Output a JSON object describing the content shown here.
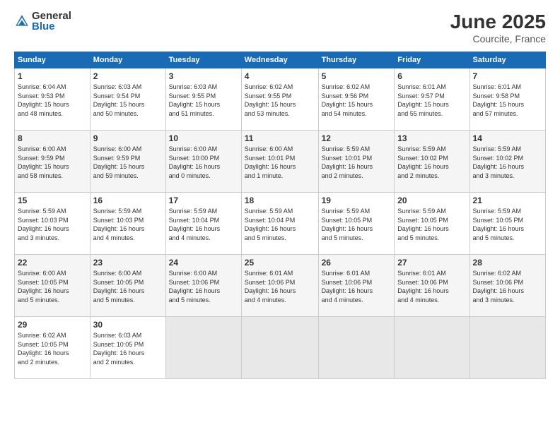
{
  "logo": {
    "general": "General",
    "blue": "Blue"
  },
  "title": "June 2025",
  "subtitle": "Courcite, France",
  "weekdays": [
    "Sunday",
    "Monday",
    "Tuesday",
    "Wednesday",
    "Thursday",
    "Friday",
    "Saturday"
  ],
  "weeks": [
    [
      {
        "day": "1",
        "info": "Sunrise: 6:04 AM\nSunset: 9:53 PM\nDaylight: 15 hours\nand 48 minutes."
      },
      {
        "day": "2",
        "info": "Sunrise: 6:03 AM\nSunset: 9:54 PM\nDaylight: 15 hours\nand 50 minutes."
      },
      {
        "day": "3",
        "info": "Sunrise: 6:03 AM\nSunset: 9:55 PM\nDaylight: 15 hours\nand 51 minutes."
      },
      {
        "day": "4",
        "info": "Sunrise: 6:02 AM\nSunset: 9:55 PM\nDaylight: 15 hours\nand 53 minutes."
      },
      {
        "day": "5",
        "info": "Sunrise: 6:02 AM\nSunset: 9:56 PM\nDaylight: 15 hours\nand 54 minutes."
      },
      {
        "day": "6",
        "info": "Sunrise: 6:01 AM\nSunset: 9:57 PM\nDaylight: 15 hours\nand 55 minutes."
      },
      {
        "day": "7",
        "info": "Sunrise: 6:01 AM\nSunset: 9:58 PM\nDaylight: 15 hours\nand 57 minutes."
      }
    ],
    [
      {
        "day": "8",
        "info": "Sunrise: 6:00 AM\nSunset: 9:59 PM\nDaylight: 15 hours\nand 58 minutes."
      },
      {
        "day": "9",
        "info": "Sunrise: 6:00 AM\nSunset: 9:59 PM\nDaylight: 15 hours\nand 59 minutes."
      },
      {
        "day": "10",
        "info": "Sunrise: 6:00 AM\nSunset: 10:00 PM\nDaylight: 16 hours\nand 0 minutes."
      },
      {
        "day": "11",
        "info": "Sunrise: 6:00 AM\nSunset: 10:01 PM\nDaylight: 16 hours\nand 1 minute."
      },
      {
        "day": "12",
        "info": "Sunrise: 5:59 AM\nSunset: 10:01 PM\nDaylight: 16 hours\nand 2 minutes."
      },
      {
        "day": "13",
        "info": "Sunrise: 5:59 AM\nSunset: 10:02 PM\nDaylight: 16 hours\nand 2 minutes."
      },
      {
        "day": "14",
        "info": "Sunrise: 5:59 AM\nSunset: 10:02 PM\nDaylight: 16 hours\nand 3 minutes."
      }
    ],
    [
      {
        "day": "15",
        "info": "Sunrise: 5:59 AM\nSunset: 10:03 PM\nDaylight: 16 hours\nand 3 minutes."
      },
      {
        "day": "16",
        "info": "Sunrise: 5:59 AM\nSunset: 10:03 PM\nDaylight: 16 hours\nand 4 minutes."
      },
      {
        "day": "17",
        "info": "Sunrise: 5:59 AM\nSunset: 10:04 PM\nDaylight: 16 hours\nand 4 minutes."
      },
      {
        "day": "18",
        "info": "Sunrise: 5:59 AM\nSunset: 10:04 PM\nDaylight: 16 hours\nand 5 minutes."
      },
      {
        "day": "19",
        "info": "Sunrise: 5:59 AM\nSunset: 10:05 PM\nDaylight: 16 hours\nand 5 minutes."
      },
      {
        "day": "20",
        "info": "Sunrise: 5:59 AM\nSunset: 10:05 PM\nDaylight: 16 hours\nand 5 minutes."
      },
      {
        "day": "21",
        "info": "Sunrise: 5:59 AM\nSunset: 10:05 PM\nDaylight: 16 hours\nand 5 minutes."
      }
    ],
    [
      {
        "day": "22",
        "info": "Sunrise: 6:00 AM\nSunset: 10:05 PM\nDaylight: 16 hours\nand 5 minutes."
      },
      {
        "day": "23",
        "info": "Sunrise: 6:00 AM\nSunset: 10:05 PM\nDaylight: 16 hours\nand 5 minutes."
      },
      {
        "day": "24",
        "info": "Sunrise: 6:00 AM\nSunset: 10:06 PM\nDaylight: 16 hours\nand 5 minutes."
      },
      {
        "day": "25",
        "info": "Sunrise: 6:01 AM\nSunset: 10:06 PM\nDaylight: 16 hours\nand 4 minutes."
      },
      {
        "day": "26",
        "info": "Sunrise: 6:01 AM\nSunset: 10:06 PM\nDaylight: 16 hours\nand 4 minutes."
      },
      {
        "day": "27",
        "info": "Sunrise: 6:01 AM\nSunset: 10:06 PM\nDaylight: 16 hours\nand 4 minutes."
      },
      {
        "day": "28",
        "info": "Sunrise: 6:02 AM\nSunset: 10:06 PM\nDaylight: 16 hours\nand 3 minutes."
      }
    ],
    [
      {
        "day": "29",
        "info": "Sunrise: 6:02 AM\nSunset: 10:05 PM\nDaylight: 16 hours\nand 2 minutes."
      },
      {
        "day": "30",
        "info": "Sunrise: 6:03 AM\nSunset: 10:05 PM\nDaylight: 16 hours\nand 2 minutes."
      },
      {
        "day": "",
        "info": ""
      },
      {
        "day": "",
        "info": ""
      },
      {
        "day": "",
        "info": ""
      },
      {
        "day": "",
        "info": ""
      },
      {
        "day": "",
        "info": ""
      }
    ]
  ]
}
